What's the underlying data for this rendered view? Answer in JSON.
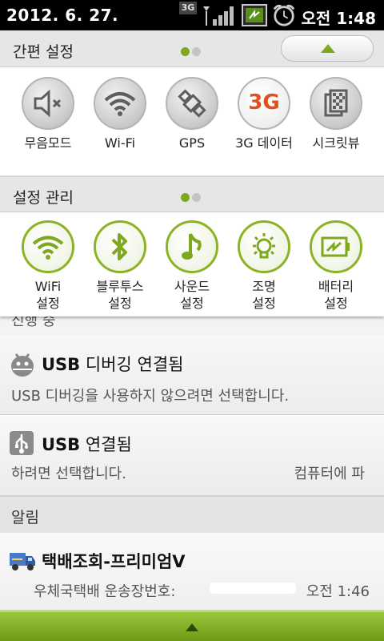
{
  "status_bar": {
    "date": "2012. 6. 27.",
    "net_type": "3G",
    "time": "오전 1:48"
  },
  "quick_settings": {
    "title": "간편 설정",
    "items": [
      {
        "label": "무음모드",
        "icon": "mute-icon"
      },
      {
        "label": "Wi-Fi",
        "icon": "wifi-icon"
      },
      {
        "label": "GPS",
        "icon": "gps-icon"
      },
      {
        "label": "3G 데이터",
        "icon": "3g-data-icon",
        "icon_text": "3G"
      },
      {
        "label": "시크릿뷰",
        "icon": "secret-view-icon"
      }
    ]
  },
  "settings_management": {
    "title": "설정 관리",
    "items": [
      {
        "label": "WiFi\n설정",
        "icon": "wifi-settings-icon"
      },
      {
        "label": "블루투스\n설정",
        "icon": "bluetooth-icon"
      },
      {
        "label": "사운드\n설정",
        "icon": "music-note-icon"
      },
      {
        "label": "조명\n설정",
        "icon": "light-bulb-icon"
      },
      {
        "label": "배터리\n설정",
        "icon": "battery-icon"
      }
    ]
  },
  "ongoing_header_partial": "진행 중",
  "notifications": [
    {
      "title_bold": "USB",
      "title_rest": " 디버깅 연결됨",
      "subtitle": "USB 디버깅을 사용하지 않으려면 선택합니다.",
      "icon": "android-debug-icon"
    },
    {
      "title_bold": "USB",
      "title_rest": " 연결됨",
      "subtitle_left": "하려면 선택합니다.",
      "subtitle_right": "컴퓨터에 파",
      "icon": "usb-icon"
    }
  ],
  "alerts": {
    "header": "알림",
    "items": [
      {
        "title": "택배조회-프리미엄V",
        "subtitle": "우체국택배 운송장번호:",
        "time": "오전 1:46",
        "icon": "delivery-truck-icon"
      }
    ]
  },
  "colors": {
    "accent": "#7ea81f",
    "status_bar_bg": "#000000",
    "bottom_bar": "#8ab82c",
    "data_3g_text": "#e0501e"
  }
}
